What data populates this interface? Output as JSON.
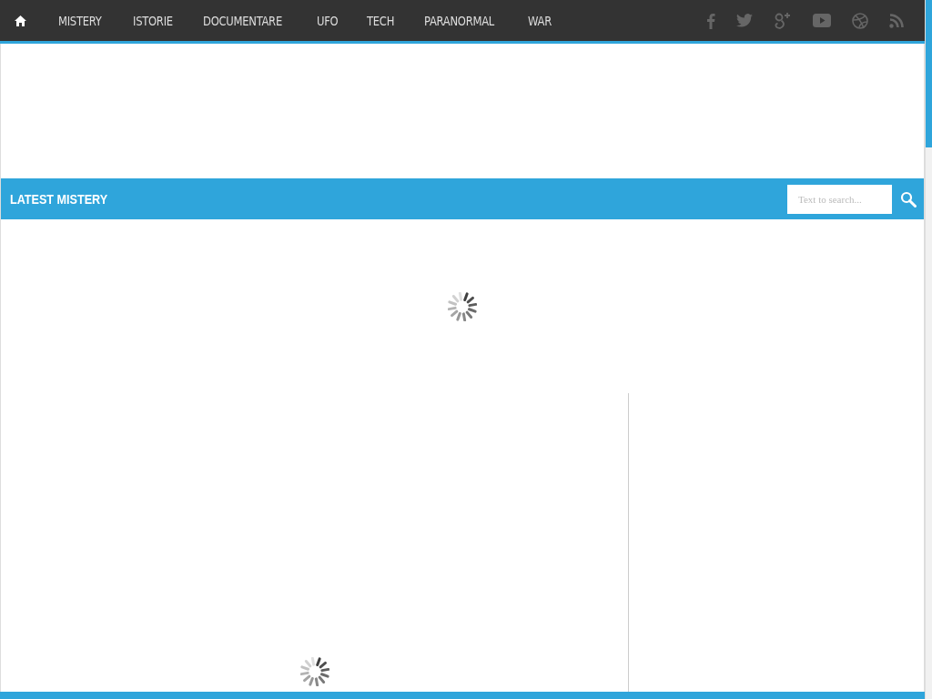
{
  "nav": {
    "items": [
      {
        "label": "MISTERY"
      },
      {
        "label": "ISTORIE"
      },
      {
        "label": "DOCUMENTARE"
      },
      {
        "label": "UFO"
      },
      {
        "label": "TECH"
      },
      {
        "label": "PARANORMAL"
      },
      {
        "label": "WAR"
      }
    ],
    "social": [
      {
        "kind": "facebook"
      },
      {
        "kind": "twitter"
      },
      {
        "kind": "googleplus"
      },
      {
        "kind": "youtube"
      },
      {
        "kind": "dribbble"
      },
      {
        "kind": "rss"
      }
    ]
  },
  "section": {
    "title": "LATEST MISTERY",
    "search": {
      "placeholder": "Text to search..."
    }
  }
}
